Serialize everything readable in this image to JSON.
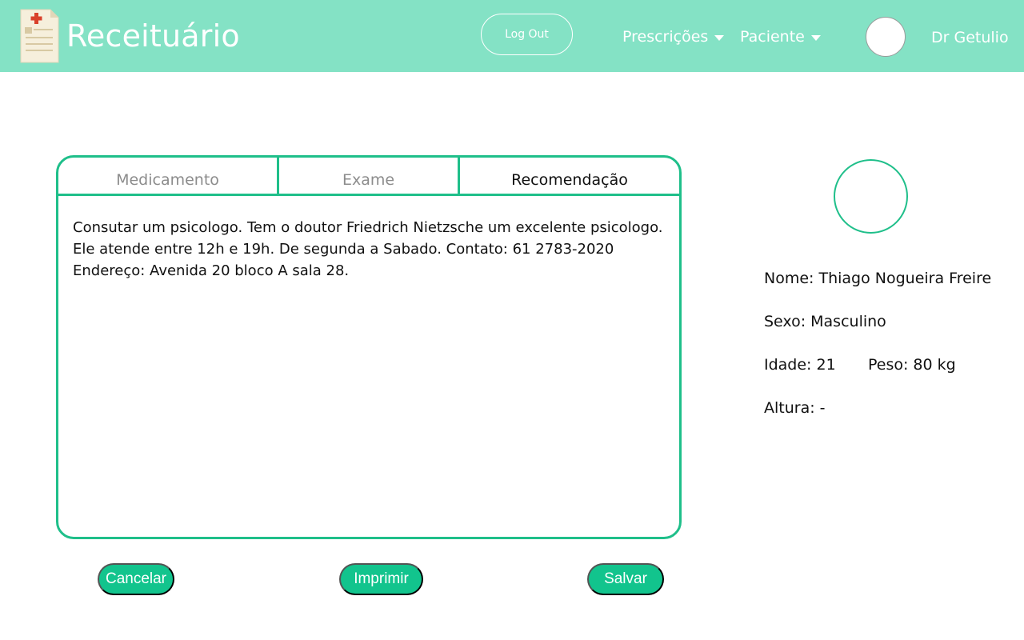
{
  "header": {
    "app_title": "Receituário",
    "logout_label": "Log Out",
    "nav": [
      {
        "label": "Prescrições"
      },
      {
        "label": "Paciente"
      }
    ],
    "doctor_name": "Dr Getulio"
  },
  "prescription": {
    "tabs": [
      {
        "label": "Medicamento",
        "active": false
      },
      {
        "label": "Exame",
        "active": false
      },
      {
        "label": "Recomendação",
        "active": true
      }
    ],
    "text_lines": [
      "Consutar um psicologo.  Tem o doutor Friedrich Nietzsche um excelente  psicologo.",
      "Ele atende entre 12h e 19h. De segunda a Sabado. Contato: 61 2783-2020",
      "Endereço: Avenida 20 bloco A sala 28."
    ]
  },
  "actions": {
    "cancel_label": "Cancelar",
    "print_label": "Imprimir",
    "save_label": "Salvar"
  },
  "patient": {
    "name": "Nome: Thiago Nogueira Freire",
    "sex": "Sexo: Masculino",
    "age": "Idade: 21",
    "weight": "Peso: 80 kg",
    "height": "Altura: -"
  },
  "colors": {
    "header_bg": "#84e2c5",
    "accent": "#1fbf8a",
    "button_bg": "#12c48d"
  }
}
